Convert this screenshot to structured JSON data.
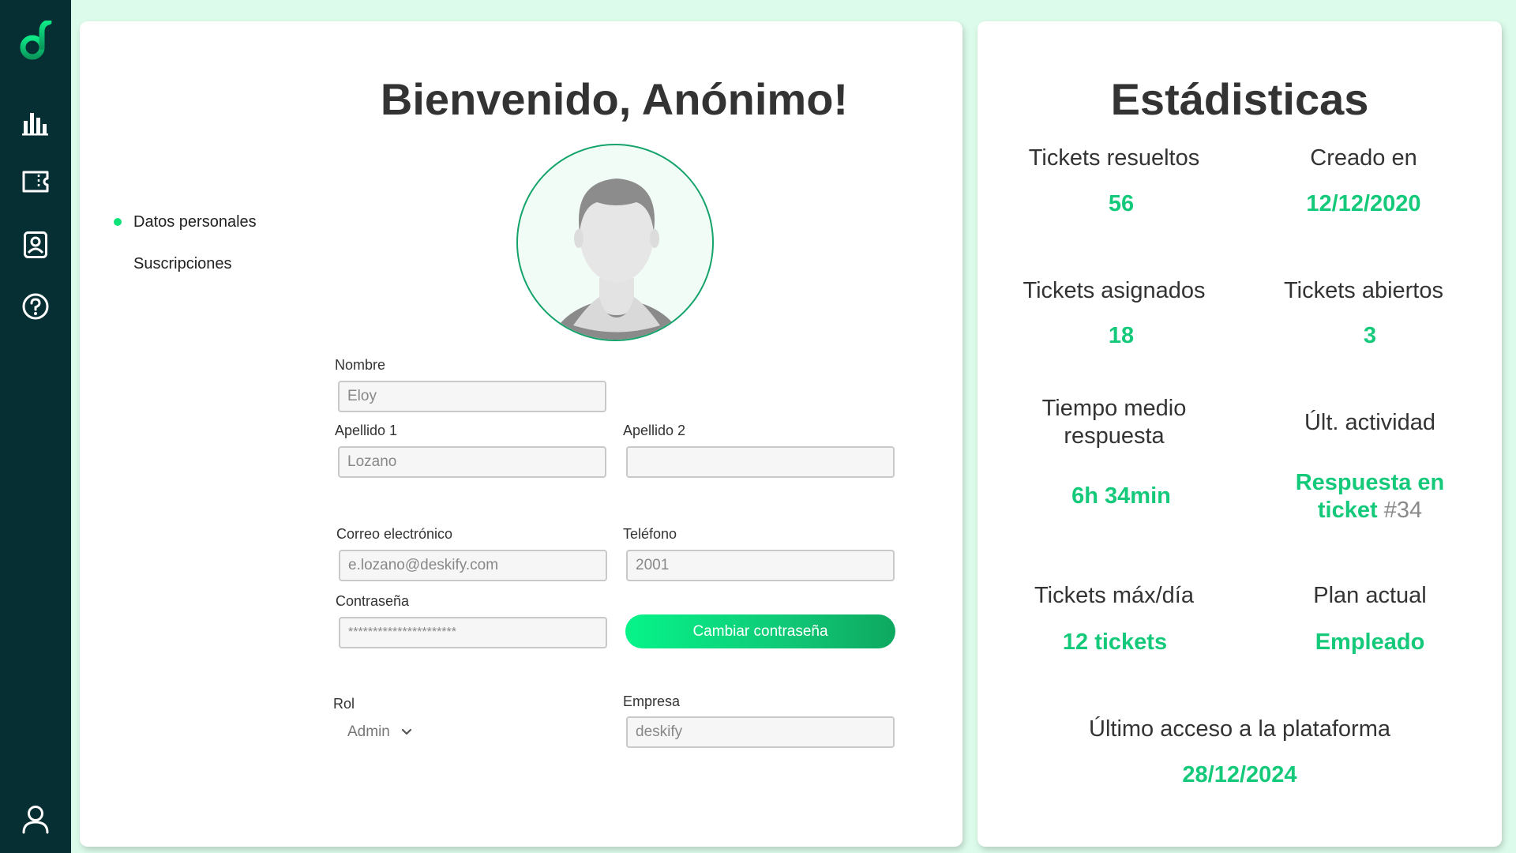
{
  "sidebar": {
    "logo": "deskify-logo-icon",
    "items": [
      {
        "icon": "bar-chart-icon"
      },
      {
        "icon": "ticket-icon"
      },
      {
        "icon": "contact-icon"
      },
      {
        "icon": "help-icon"
      }
    ],
    "bottom": {
      "icon": "user-icon"
    }
  },
  "profile": {
    "title": "Bienvenido, Anónimo!",
    "subnav": [
      "Datos personales",
      "Suscripciones"
    ],
    "form": {
      "nombre_label": "Nombre",
      "nombre_value": "Eloy",
      "apellido1_label": "Apellido 1",
      "apellido1_value": "Lozano",
      "apellido2_label": "Apellido 2",
      "apellido2_value": "",
      "email_label": "Correo electrónico",
      "email_value": "e.lozano@deskify.com",
      "telefono_label": "Teléfono",
      "telefono_value": "2001",
      "password_label": "Contraseña",
      "password_value": "**********************",
      "change_password_label": "Cambiar contraseña",
      "rol_label": "Rol",
      "rol_value": "Admin",
      "empresa_label": "Empresa",
      "empresa_value": "deskify"
    }
  },
  "stats": {
    "title": "Estádisticas",
    "resueltos_label": "Tickets resueltos",
    "resueltos_value": "56",
    "creado_label": "Creado en",
    "creado_value": "12/12/2020",
    "asignados_label": "Tickets asignados",
    "asignados_value": "18",
    "abiertos_label": "Tickets abiertos",
    "abiertos_value": "3",
    "tiempo_label_line1": "Tiempo medio",
    "tiempo_label_line2": "respuesta",
    "tiempo_value": "6h 34min",
    "actividad_label": "Últ. actividad",
    "actividad_value_line1": "Respuesta en",
    "actividad_value_line2": "ticket",
    "actividad_value_ref": "#34",
    "maxdia_label": "Tickets máx/día",
    "maxdia_value": "12 tickets",
    "plan_label": "Plan actual",
    "plan_value": "Empleado",
    "ultimo_acceso_label": "Último acceso a la plataforma",
    "ultimo_acceso_value": "28/12/2024"
  },
  "colors": {
    "sidebar": "#062f33",
    "accent": "#15c97a",
    "background": "#dcfbea"
  }
}
